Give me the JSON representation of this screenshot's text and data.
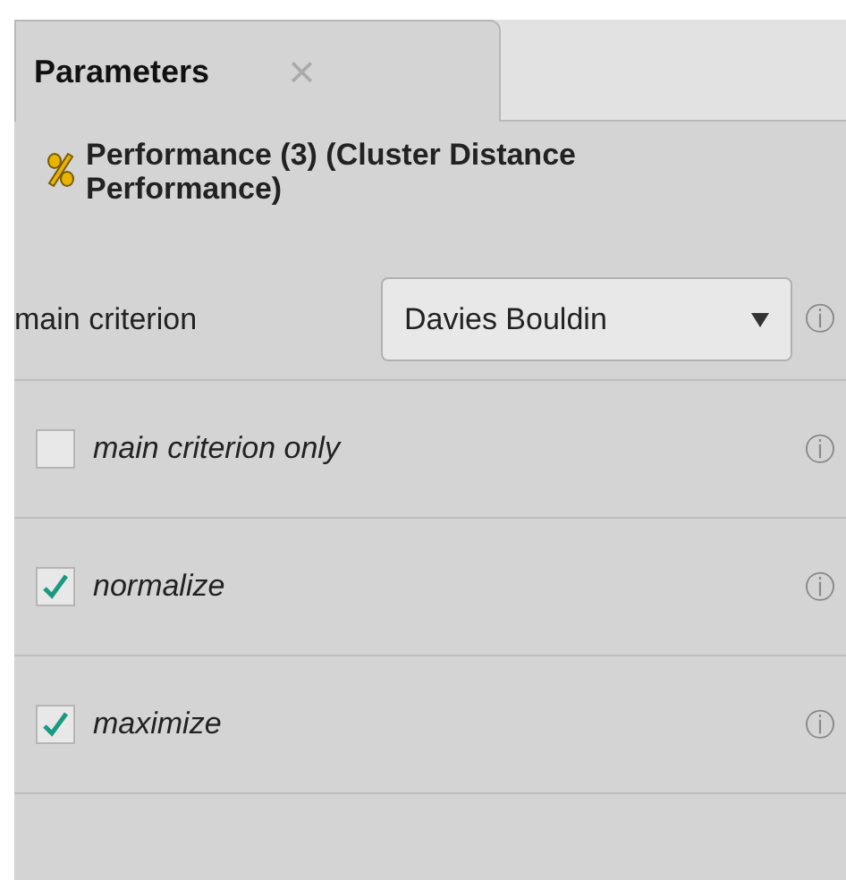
{
  "tab": {
    "label": "Parameters",
    "close": "×",
    "selected": true
  },
  "operator": {
    "title": "Performance (3) (Cluster Distance Performance)"
  },
  "parameters": [
    {
      "kind": "select",
      "label": "main criterion",
      "value": "Davies Bouldin",
      "info": "ⓘ"
    },
    {
      "kind": "checkbox",
      "label": "main criterion only",
      "checked": false,
      "info": "ⓘ"
    },
    {
      "kind": "checkbox",
      "label": "normalize",
      "checked": true,
      "info": "ⓘ"
    },
    {
      "kind": "checkbox",
      "label": "maximize",
      "checked": true,
      "info": "ⓘ"
    }
  ]
}
